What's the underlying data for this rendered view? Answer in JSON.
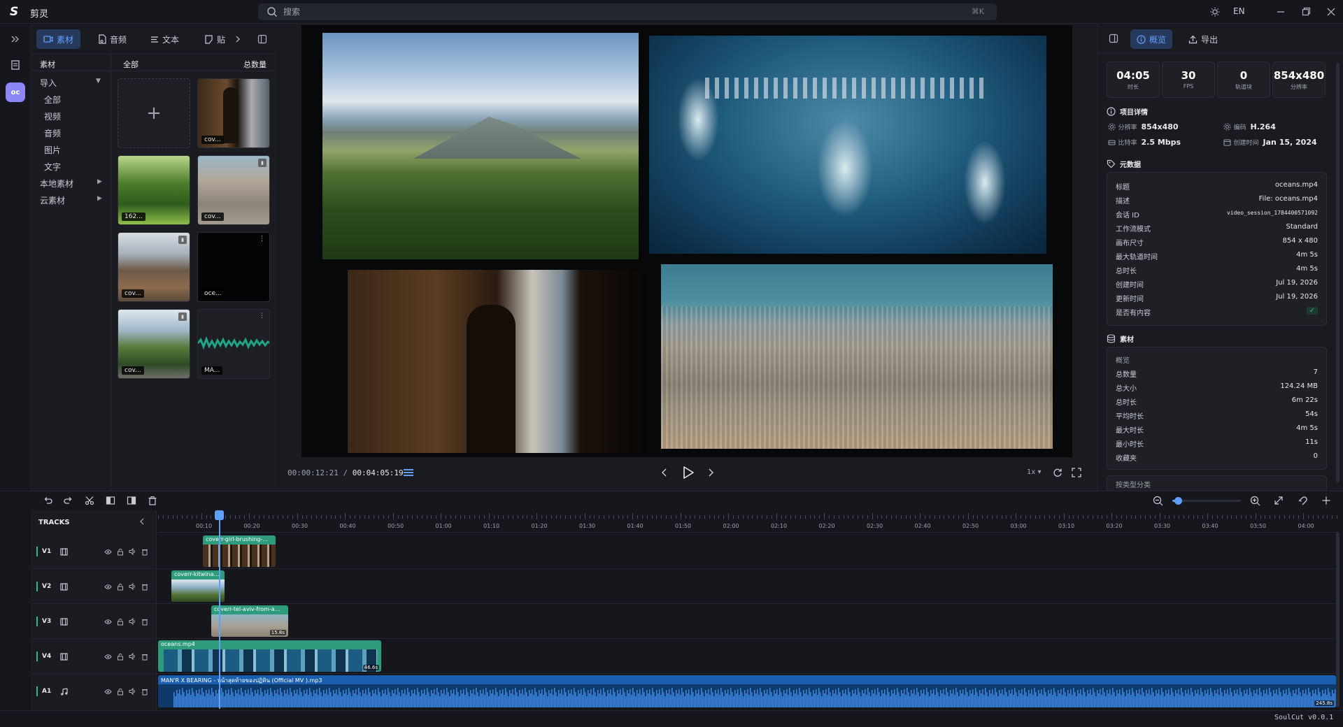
{
  "app": {
    "title": "剪灵",
    "logo": "S",
    "version": "SoulCut v0.0.1"
  },
  "search": {
    "placeholder": "搜索",
    "shortcut": "⌘K"
  },
  "titlebar": {
    "lang": "EN"
  },
  "rail": {
    "avatar": "oc"
  },
  "left_tabs": [
    {
      "label": "素材",
      "icon": "video-icon",
      "active": true
    },
    {
      "label": "音频",
      "icon": "music-file-icon"
    },
    {
      "label": "文本",
      "icon": "text-lines-icon"
    },
    {
      "label": "贴",
      "icon": "sticker-icon"
    }
  ],
  "categories": {
    "header": "素材",
    "items": [
      "导入",
      "全部",
      "视频",
      "音频",
      "图片",
      "文字",
      "本地素材",
      "云素材"
    ]
  },
  "media_panel": {
    "header_all": "全部",
    "header_count": "总数量",
    "add_label": "+",
    "thumbs": [
      "cov...",
      "162...",
      "cov...",
      "cov...",
      "oce...",
      "cov...",
      "MA..."
    ]
  },
  "player": {
    "current_time": "00:00:12:21",
    "separator": "/",
    "total_time": "00:04:05:19",
    "speed": "1x ▾"
  },
  "right_tabs": [
    {
      "label": "概览",
      "icon": "info-icon",
      "active": true
    },
    {
      "label": "导出",
      "icon": "upload-icon"
    }
  ],
  "stats": [
    {
      "value": "04:05",
      "label": "时长"
    },
    {
      "value": "30",
      "label": "FPS"
    },
    {
      "value": "0",
      "label": "轨道块"
    },
    {
      "value": "854x480",
      "label": "分辨率"
    }
  ],
  "project_details": {
    "title": "项目详情",
    "resolution_label": "分辨率",
    "resolution": "854x480",
    "codec_label": "编码",
    "codec": "H.264",
    "bitrate_label": "比特率",
    "bitrate": "2.5 Mbps",
    "created_label": "创建时间",
    "created": "Jan 15, 2024"
  },
  "metadata": {
    "title": "元数据",
    "rows": [
      {
        "k": "标题",
        "v": "oceans.mp4"
      },
      {
        "k": "描述",
        "v": "File: oceans.mp4"
      },
      {
        "k": "会话 ID",
        "v": "video_session_1784400571092"
      },
      {
        "k": "工作流模式",
        "v": "Standard"
      },
      {
        "k": "画布尺寸",
        "v": "854 x 480"
      },
      {
        "k": "最大轨道时间",
        "v": "4m 5s"
      },
      {
        "k": "总时长",
        "v": "4m 5s"
      },
      {
        "k": "创建时间",
        "v": "Jul 19, 2026"
      },
      {
        "k": "更新时间",
        "v": "Jul 19, 2026"
      },
      {
        "k": "是否有内容",
        "v": "✓"
      }
    ]
  },
  "assets": {
    "title": "素材",
    "overview": "概览",
    "rows": [
      {
        "k": "总数量",
        "v": "7"
      },
      {
        "k": "总大小",
        "v": "124.24 MB"
      },
      {
        "k": "总时长",
        "v": "6m 22s"
      },
      {
        "k": "平均时长",
        "v": "54s"
      },
      {
        "k": "最大时长",
        "v": "4m 5s"
      },
      {
        "k": "最小时长",
        "v": "11s"
      },
      {
        "k": "收藏夹",
        "v": "0"
      }
    ],
    "more": "按类型分类"
  },
  "timeline": {
    "tracks_label": "TRACKS",
    "zoom_level": 0.05,
    "ticks": [
      "00:10",
      "00:20",
      "00:30",
      "00:40",
      "00:50",
      "01:00",
      "01:10",
      "01:20",
      "01:30",
      "01:40",
      "01:50",
      "02:00",
      "02:10",
      "02:20",
      "02:30",
      "02:40",
      "02:50",
      "03:00",
      "03:10",
      "03:20",
      "03:30",
      "03:40",
      "03:50",
      "04:00"
    ],
    "tracks": [
      {
        "name": "V1",
        "type": "video"
      },
      {
        "name": "V2",
        "type": "video"
      },
      {
        "name": "V3",
        "type": "video"
      },
      {
        "name": "V4",
        "type": "video"
      },
      {
        "name": "A1",
        "type": "audio"
      }
    ],
    "clips": [
      {
        "name": "coverr-girl-brushing-...",
        "duration": ""
      },
      {
        "name": "coverr-kitwina...",
        "duration": ""
      },
      {
        "name": "coverr-tel-aviv-from-a...",
        "duration": "15.8s"
      },
      {
        "name": "oceans.mp4",
        "duration": "46.6s"
      },
      {
        "name": "MAN'R X BEARING - หน้าสุดท้ายของปฏิทิน (Official MV ).mp3",
        "duration": "245.8s"
      }
    ]
  },
  "colors": {
    "accent": "#5fa0ff",
    "clip_green": "#2e9b7c",
    "audio_blue": "#1a5fae",
    "bg": "#17181d"
  }
}
